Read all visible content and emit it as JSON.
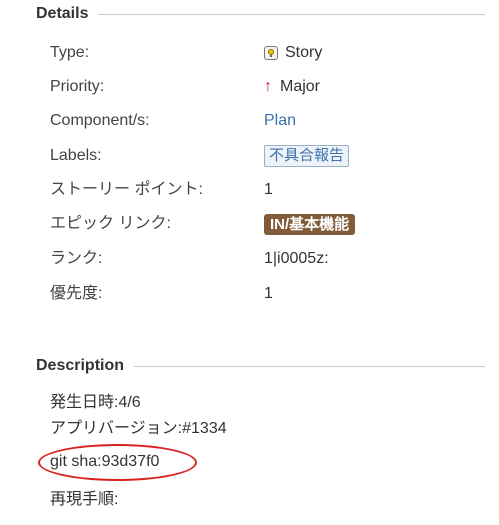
{
  "details": {
    "title": "Details",
    "fields": {
      "type": {
        "label": "Type:",
        "value": "Story",
        "icon": "story-icon"
      },
      "priority": {
        "label": "Priority:",
        "value": "Major",
        "icon": "arrow-up-icon",
        "icon_glyph": "↑",
        "icon_color": "#c0272d"
      },
      "components": {
        "label": "Component/s:",
        "value": "Plan"
      },
      "labels": {
        "label": "Labels:",
        "value": "不具合報告"
      },
      "story_points": {
        "label": "ストーリー ポイント:",
        "value": "1"
      },
      "epic_link": {
        "label": "エピック リンク:",
        "value": "IN/基本機能",
        "color": "#815b3a"
      },
      "rank": {
        "label": "ランク:",
        "value": "1|i0005z:"
      },
      "priority_level": {
        "label": "優先度:",
        "value": "1"
      }
    }
  },
  "description": {
    "title": "Description",
    "lines": [
      "発生日時:4/6",
      "アプリバージョン:#1334",
      "git sha:93d37f0",
      "再現手順:"
    ],
    "annotation_color": "#d8231f"
  }
}
